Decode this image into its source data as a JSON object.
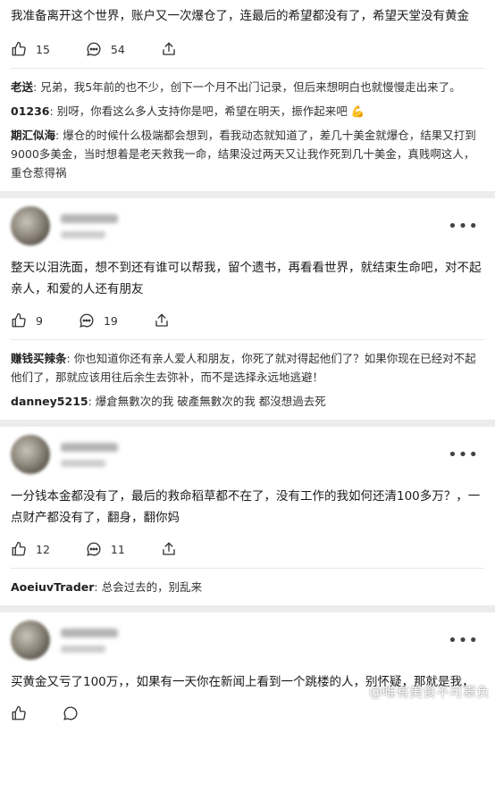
{
  "posts": [
    {
      "text": "我准备离开这个世界，账户又一次爆仓了，连最后的希望都没有了，希望天堂没有黄金",
      "likes": "15",
      "comments_count": "54",
      "comments": [
        {
          "author": "老送",
          "text": "兄弟，我5年前的也不少，创下一个月不出门记录，但后来想明白也就慢慢走出来了。"
        },
        {
          "author": "01236",
          "text": "别呀，你看这么多人支持你是吧，希望在明天，振作起来吧 💪"
        },
        {
          "author": "期汇似海",
          "text": "爆仓的时候什么极端都会想到，看我动态就知道了，差几十美金就爆仓，结果又打到9000多美金，当时想着是老天救我一命，结果没过两天又让我作死到几十美金，真贱啊这人，重仓惹得祸"
        }
      ]
    },
    {
      "text": "整天以泪洗面，想不到还有谁可以帮我，留个遗书，再看看世界，就结束生命吧，对不起亲人，和爱的人还有朋友",
      "likes": "9",
      "comments_count": "19",
      "comments": [
        {
          "author": "赚钱买辣条",
          "text": "你也知道你还有亲人爱人和朋友，你死了就对得起他们了？如果你现在已经对不起他们了，那就应该用往后余生去弥补，而不是选择永远地逃避！"
        },
        {
          "author": "danney5215",
          "text": "爆倉無數次的我 破產無數次的我 都沒想過去死"
        }
      ]
    },
    {
      "text": "一分钱本金都没有了，最后的救命稻草都不在了，没有工作的我如何还清100多万？，一点财产都没有了，翻身，翻你妈",
      "likes": "12",
      "comments_count": "11",
      "comments": [
        {
          "author": "AoeiuvTrader",
          "text": "总会过去的，别乱来"
        }
      ]
    },
    {
      "text": "买黄金又亏了100万，，如果有一天你在新闻上看到一个跳楼的人，别怀疑，那就是我，",
      "likes": "",
      "comments_count": ""
    }
  ],
  "more_label": "•••",
  "watermark": "@唯有美食不可辜负",
  "icons": {
    "like": "thumbs-up-icon",
    "comment": "comment-bubble-icon",
    "share": "share-icon",
    "more": "more-dots-icon"
  }
}
